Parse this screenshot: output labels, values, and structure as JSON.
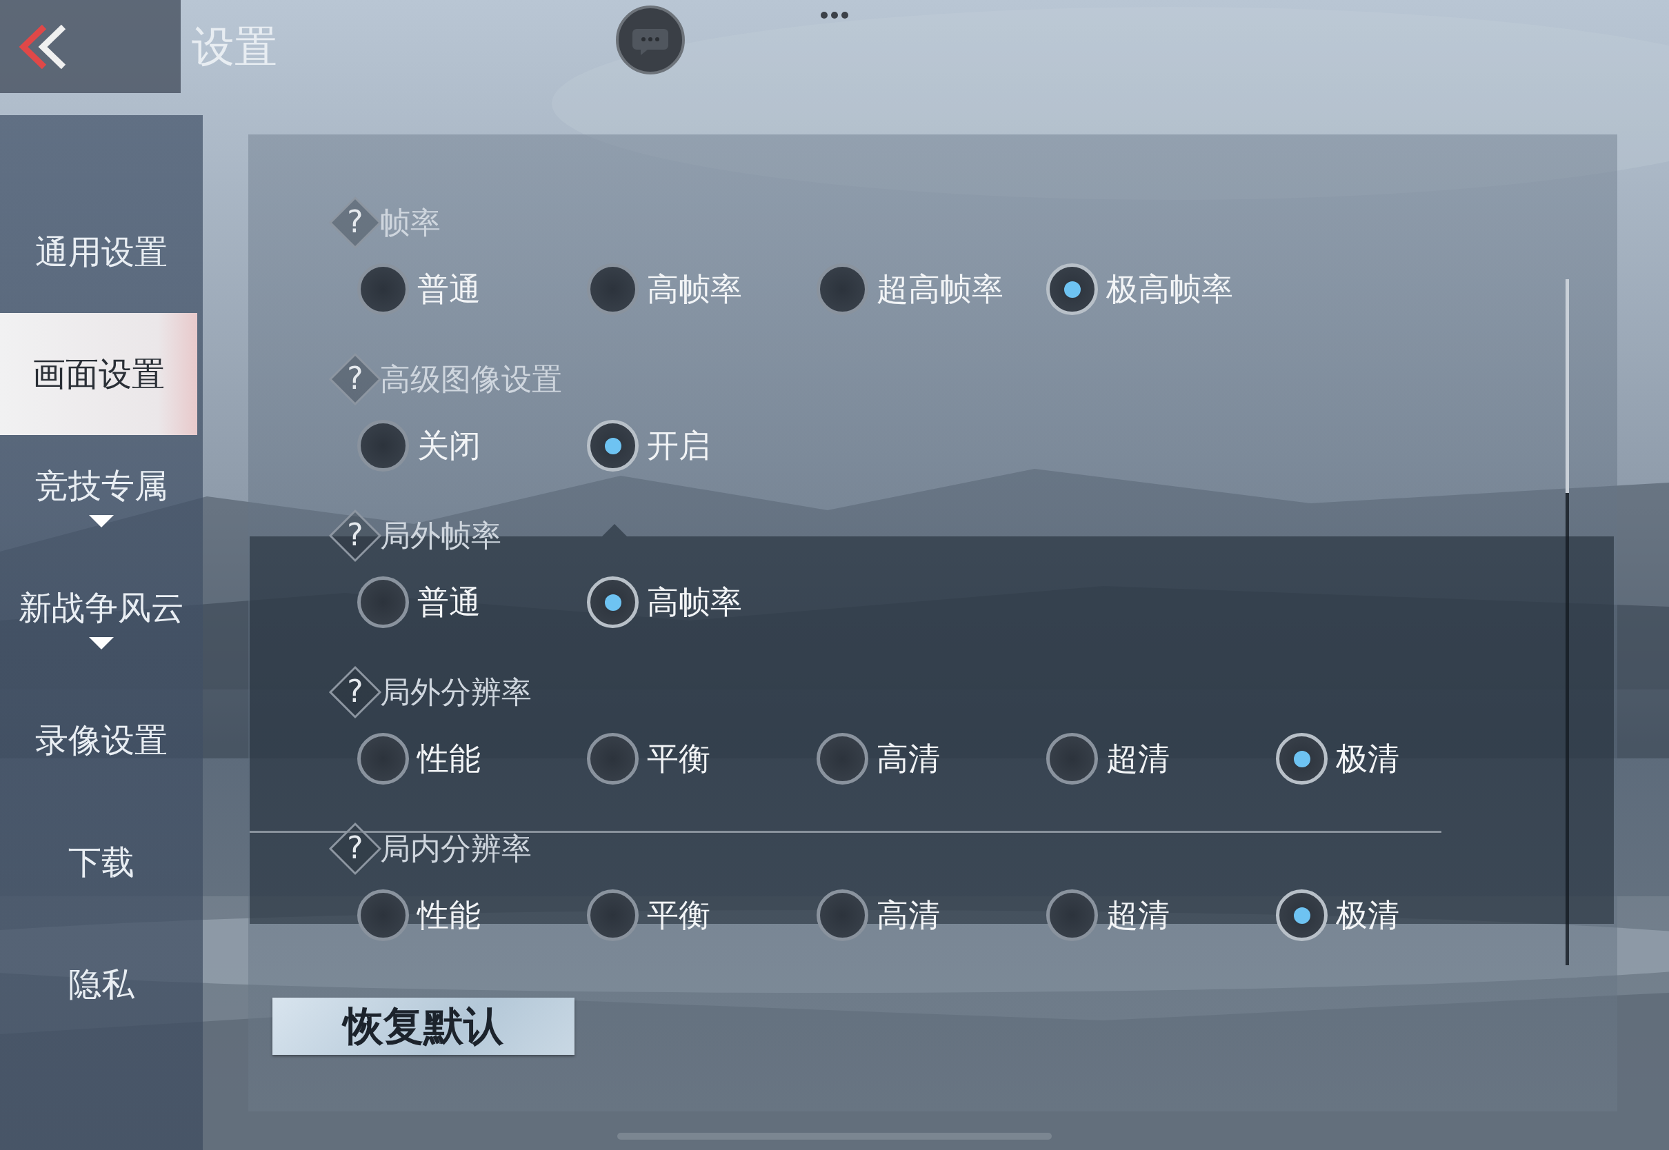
{
  "header": {
    "title": "设置"
  },
  "sidebar": {
    "items": [
      {
        "label": "通用设置",
        "selected": false,
        "expandable": false
      },
      {
        "label": "画面设置",
        "selected": true,
        "expandable": false
      },
      {
        "label": "竞技专属",
        "selected": false,
        "expandable": true
      },
      {
        "label": "新战争风云",
        "selected": false,
        "expandable": true
      },
      {
        "label": "录像设置",
        "selected": false,
        "expandable": false
      },
      {
        "label": "下载",
        "selected": false,
        "expandable": false
      },
      {
        "label": "隐私",
        "selected": false,
        "expandable": false
      }
    ]
  },
  "settings": [
    {
      "help": "?",
      "label": "帧率",
      "options": [
        {
          "label": "普通",
          "selected": false
        },
        {
          "label": "高帧率",
          "selected": false
        },
        {
          "label": "超高帧率",
          "selected": false
        },
        {
          "label": "极高帧率",
          "selected": true
        }
      ]
    },
    {
      "help": "?",
      "label": "高级图像设置",
      "options": [
        {
          "label": "关闭",
          "selected": false
        },
        {
          "label": "开启",
          "selected": true
        }
      ]
    },
    {
      "help": "?",
      "label": "局外帧率",
      "options": [
        {
          "label": "普通",
          "selected": false
        },
        {
          "label": "高帧率",
          "selected": true
        }
      ]
    },
    {
      "help": "?",
      "label": "局外分辨率",
      "options": [
        {
          "label": "性能",
          "selected": false
        },
        {
          "label": "平衡",
          "selected": false
        },
        {
          "label": "高清",
          "selected": false
        },
        {
          "label": "超清",
          "selected": false
        },
        {
          "label": "极清",
          "selected": true
        }
      ]
    },
    {
      "help": "?",
      "label": "局内分辨率",
      "options": [
        {
          "label": "性能",
          "selected": false
        },
        {
          "label": "平衡",
          "selected": false
        },
        {
          "label": "高清",
          "selected": false
        },
        {
          "label": "超清",
          "selected": false
        },
        {
          "label": "极清",
          "selected": true
        }
      ]
    }
  ],
  "reset_button": "恢复默认"
}
